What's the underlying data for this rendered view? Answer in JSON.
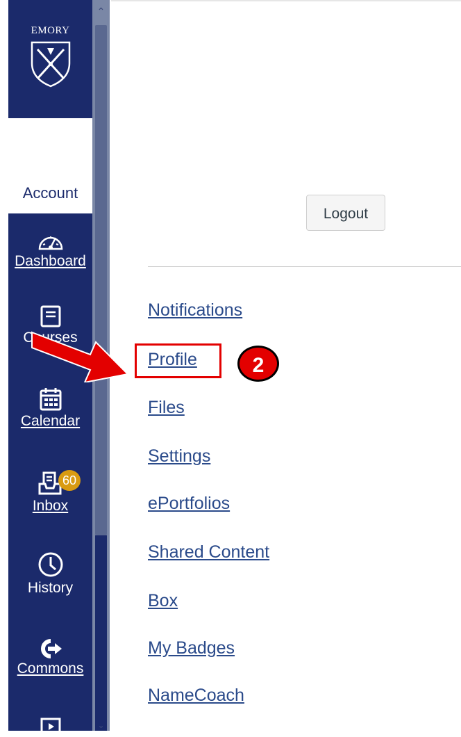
{
  "nav": {
    "logo_text": "EMORY",
    "account_label": "Account",
    "items": [
      {
        "label": "Dashboard",
        "icon": "dashboard-icon"
      },
      {
        "label": "Courses",
        "icon": "courses-icon"
      },
      {
        "label": "Calendar",
        "icon": "calendar-icon"
      },
      {
        "label": "Inbox",
        "icon": "inbox-icon",
        "badge": "60"
      },
      {
        "label": "History",
        "icon": "history-icon"
      },
      {
        "label": "Commons",
        "icon": "commons-icon"
      }
    ]
  },
  "account_panel": {
    "logout_label": "Logout",
    "links": [
      "Notifications",
      "Profile",
      "Files",
      "Settings",
      "ePortfolios",
      "Shared Content",
      "Box",
      "My Badges",
      "NameCoach"
    ]
  },
  "annotation": {
    "step_number": "2",
    "highlight_color": "#e30000"
  },
  "colors": {
    "nav_background": "#1b2a6b",
    "badge": "#d99b12",
    "link": "#2a4a8a"
  }
}
